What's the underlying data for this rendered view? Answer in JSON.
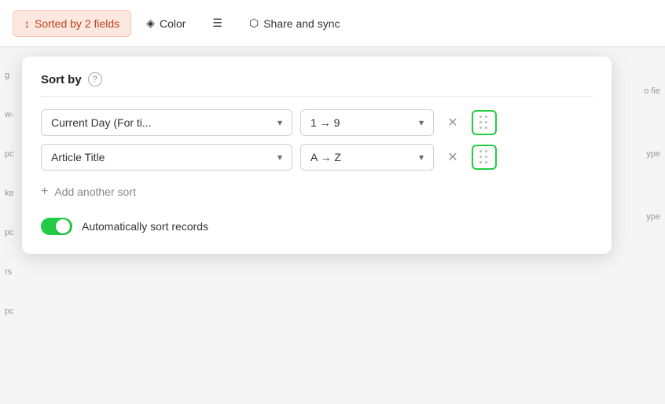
{
  "toolbar": {
    "sort_btn_label": "Sorted by 2 fields",
    "color_btn_label": "Color",
    "filter_icon_label": "Filter",
    "share_btn_label": "Share and sync"
  },
  "sort_panel": {
    "title": "Sort by",
    "help_tooltip": "?",
    "divider": true,
    "rows": [
      {
        "id": "row1",
        "field_value": "Current Day (For ti...",
        "order_value": "1 → 9"
      },
      {
        "id": "row2",
        "field_value": "Article Title",
        "order_value": "A → Z"
      }
    ],
    "add_sort_label": "Add another sort",
    "auto_sort_label": "Automatically sort records",
    "auto_sort_enabled": true
  },
  "background": {
    "side_labels": [
      "g",
      "w-",
      "pc",
      "ke",
      "pc",
      "rs",
      "pc"
    ],
    "right_labels": [
      "o fie",
      "ype",
      "ype"
    ]
  },
  "colors": {
    "sorted_bg": "#fde8e0",
    "sorted_text": "#c04020",
    "highlight_green": "#22cc44",
    "toggle_on": "#22cc44"
  }
}
